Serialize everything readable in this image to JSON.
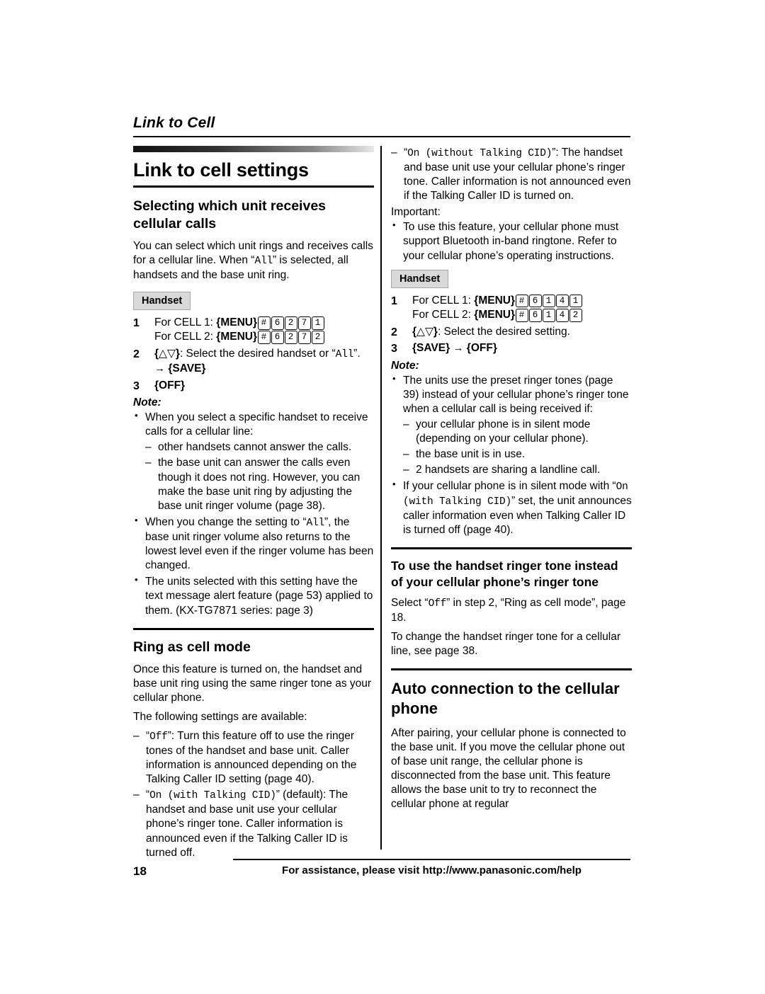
{
  "header": {
    "running_title": "Link to Cell"
  },
  "left_column": {
    "chapter_title": "Link to cell settings",
    "section1": {
      "heading": "Selecting which unit receives cellular calls",
      "intro_a": "You can select which unit rings and receives calls for a cellular line. When “",
      "intro_all": "All",
      "intro_b": "” is selected, all handsets and the base unit ring.",
      "handset_badge": "Handset",
      "steps": [
        {
          "num": "1",
          "line1_pre": "For CELL 1: ",
          "line1_key": "MENU",
          "line1_digits": [
            "#",
            "6",
            "2",
            "7",
            "1"
          ],
          "line2_pre": "For CELL 2: ",
          "line2_key": "MENU",
          "line2_digits": [
            "#",
            "6",
            "2",
            "7",
            "2"
          ]
        },
        {
          "num": "2",
          "text_a": ": Select the desired handset or “",
          "text_all": "All",
          "text_b": "”.",
          "arrow_target": "SAVE"
        },
        {
          "num": "3",
          "text": "OFF"
        }
      ],
      "note_label": "Note:",
      "notes": [
        {
          "text": "When you select a specific handset to receive calls for a cellular line:",
          "sub": [
            "other handsets cannot answer the calls.",
            "the base unit can answer the calls even though it does not ring. However, you can make the base unit ring by adjusting the base unit ringer volume (page 38)."
          ]
        },
        {
          "text_a": "When you change the setting to “",
          "text_mono": "All",
          "text_b": "”, the base unit ringer volume also returns to the lowest level even if the ringer volume has been changed."
        },
        {
          "text": "The units selected with this setting have the text message alert feature (page 53) applied to them. (KX-TG7871 series: page 3)"
        }
      ]
    },
    "section2": {
      "heading": "Ring as cell mode",
      "para1": "Once this feature is turned on, the handset and base unit ring using the same ringer tone as your cellular phone.",
      "para2": "The following settings are available:",
      "dash_items": [
        {
          "mono": "Off",
          "text": "”: Turn this feature off to use the ringer tones of the handset and base unit. Caller information is announced depending on the Talking Caller ID setting (page 40)."
        },
        {
          "mono": "On (with Talking CID)",
          "text": "” (default): The handset and base unit use your cellular phone’s ringer tone. Caller information is announced even if the Talking Caller ID is turned off."
        }
      ]
    }
  },
  "right_column": {
    "top_dash": {
      "mono": "On (without Talking CID)",
      "text": "”: The handset and base unit use your cellular phone’s ringer tone. Caller information is not announced even if the Talking Caller ID is turned on."
    },
    "important_label": "Important:",
    "important_items": [
      "To use this feature, your cellular phone must support Bluetooth in-band ringtone. Refer to your cellular phone’s operating instructions."
    ],
    "handset_badge": "Handset",
    "steps": [
      {
        "num": "1",
        "line1_pre": "For CELL 1: ",
        "line1_key": "MENU",
        "line1_digits": [
          "#",
          "6",
          "1",
          "4",
          "1"
        ],
        "line2_pre": "For CELL 2: ",
        "line2_key": "MENU",
        "line2_digits": [
          "#",
          "6",
          "1",
          "4",
          "2"
        ]
      },
      {
        "num": "2",
        "text": ": Select the desired setting."
      },
      {
        "num": "3",
        "save": "SAVE",
        "off": "OFF"
      }
    ],
    "note_label": "Note:",
    "notes": [
      {
        "text": "The units use the preset ringer tones (page 39) instead of your cellular phone’s ringer tone when a cellular call is being received if:",
        "sub": [
          "your cellular phone is in silent mode (depending on your cellular phone).",
          "the base unit is in use.",
          "2 handsets are sharing a landline call."
        ]
      },
      {
        "text_a": "If your cellular phone is in silent mode with “",
        "text_mono": "On (with Talking CID)",
        "text_b": "” set, the unit announces caller information even when Talking Caller ID is turned off (page 40)."
      }
    ],
    "subsection": {
      "heading": "To use the handset ringer tone instead of your cellular phone’s ringer tone",
      "para1_a": "Select “",
      "para1_mono": "Off",
      "para1_b": "” in step 2, “Ring as cell mode”, page 18.",
      "para2": "To change the handset ringer tone for a cellular line, see page 38."
    },
    "section_auto": {
      "heading": "Auto connection to the cellular phone",
      "para1": "After pairing, your cellular phone is connected to the base unit. If you move the cellular phone out of base unit range, the cellular phone is disconnected from the base unit. This feature allows the base unit to try to reconnect the cellular phone at regular"
    }
  },
  "footer": {
    "page_number": "18",
    "text": "For assistance, please visit http://www.panasonic.com/help"
  }
}
